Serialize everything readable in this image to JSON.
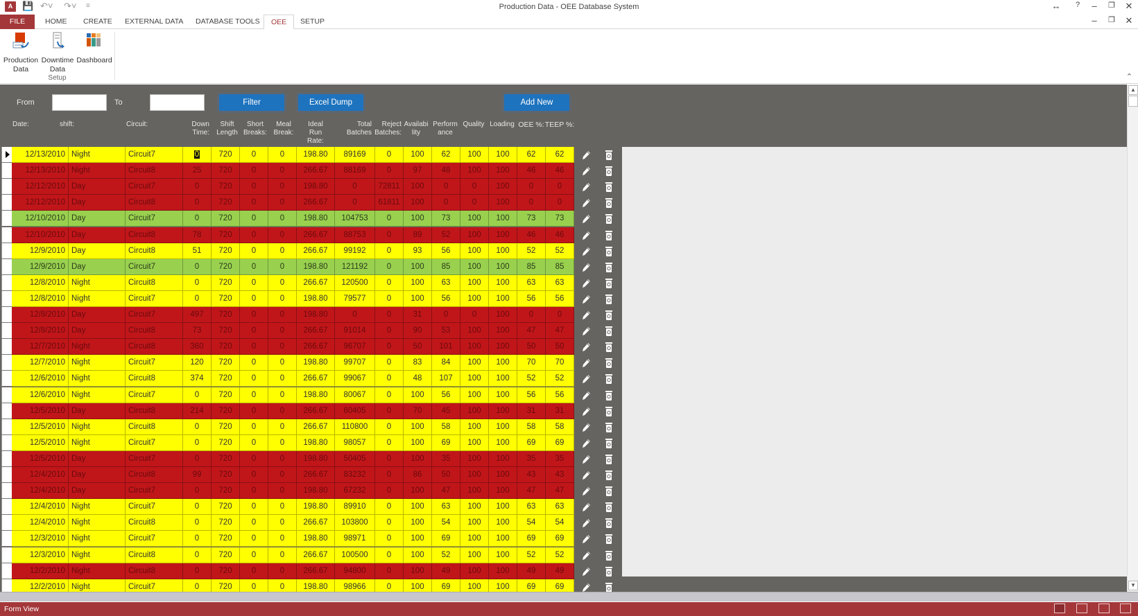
{
  "window": {
    "title": "Production Data - OEE Database System",
    "app_icon": "access-icon",
    "quick_access": [
      "save-icon",
      "undo-icon",
      "redo-icon",
      "customize-icon"
    ],
    "controls": [
      "resize-arrows-icon",
      "help-icon",
      "minimize-icon",
      "restore-icon",
      "close-icon"
    ]
  },
  "ribbon": {
    "tabs": [
      {
        "label": "FILE"
      },
      {
        "label": "HOME"
      },
      {
        "label": "CREATE"
      },
      {
        "label": "EXTERNAL DATA"
      },
      {
        "label": "DATABASE TOOLS"
      },
      {
        "label": "OEE"
      },
      {
        "label": "SETUP"
      }
    ],
    "active_tab": "OEE",
    "buttons": [
      {
        "label1": "Production",
        "label2": "Data",
        "icon": "production-data-icon"
      },
      {
        "label1": "Downtime",
        "label2": "Data",
        "icon": "downtime-data-icon"
      },
      {
        "label1": "Dashboard",
        "label2": "",
        "icon": "dashboard-icon"
      }
    ],
    "group_label": "Setup"
  },
  "filter_bar": {
    "from_label": "From",
    "from_value": "",
    "to_label": "To",
    "to_value": "",
    "filter_button": "Filter",
    "excel_button": "Excel Dump",
    "add_button": "Add New"
  },
  "columns": [
    "Date:",
    "shift:",
    "Circuit:",
    "Down\nTime:",
    "Shift\nLength",
    "Short\nBreaks:",
    "Meal\nBreak:",
    "Ideal\nRun\nRate:",
    "Total\nBatches",
    "Reject\nBatches:",
    "Availabi\nlity",
    "Perform\nance",
    "Quality",
    "Loading",
    "OEE %:",
    "TEEP %:"
  ],
  "colors": {
    "good": "#99d14f",
    "warning": "#ffff00",
    "bad": "#c0161a",
    "accent": "#a4373a",
    "button": "#1e73be"
  },
  "rows": [
    {
      "status": "yellow",
      "cells": [
        "12/13/2010",
        "Night",
        "Circuit7",
        "0",
        "720",
        "0",
        "0",
        "198.80",
        "89169",
        "0",
        "100",
        "62",
        "100",
        "100",
        "62",
        "62"
      ]
    },
    {
      "status": "red",
      "cells": [
        "12/13/2010",
        "Night",
        "Circuit8",
        "25",
        "720",
        "0",
        "0",
        "266.67",
        "88169",
        "0",
        "97",
        "48",
        "100",
        "100",
        "46",
        "46"
      ]
    },
    {
      "status": "red",
      "cells": [
        "12/12/2010",
        "Day",
        "Circuit7",
        "0",
        "720",
        "0",
        "0",
        "198.80",
        "0",
        "72811",
        "100",
        "0",
        "0",
        "100",
        "0",
        "0"
      ]
    },
    {
      "status": "red",
      "cells": [
        "12/12/2010",
        "Day",
        "Circuit8",
        "0",
        "720",
        "0",
        "0",
        "266.67",
        "0",
        "61811",
        "100",
        "0",
        "0",
        "100",
        "0",
        "0"
      ]
    },
    {
      "status": "green",
      "cells": [
        "12/10/2010",
        "Day",
        "Circuit7",
        "0",
        "720",
        "0",
        "0",
        "198.80",
        "104753",
        "0",
        "100",
        "73",
        "100",
        "100",
        "73",
        "73"
      ]
    },
    {
      "status": "red",
      "cells": [
        "12/10/2010",
        "Day",
        "Circuit8",
        "78",
        "720",
        "0",
        "0",
        "266.67",
        "88753",
        "0",
        "89",
        "52",
        "100",
        "100",
        "46",
        "46"
      ]
    },
    {
      "status": "yellow",
      "cells": [
        "12/9/2010",
        "Day",
        "Circuit8",
        "51",
        "720",
        "0",
        "0",
        "266.67",
        "99192",
        "0",
        "93",
        "56",
        "100",
        "100",
        "52",
        "52"
      ]
    },
    {
      "status": "green",
      "cells": [
        "12/9/2010",
        "Day",
        "Circuit7",
        "0",
        "720",
        "0",
        "0",
        "198.80",
        "121192",
        "0",
        "100",
        "85",
        "100",
        "100",
        "85",
        "85"
      ]
    },
    {
      "status": "yellow",
      "cells": [
        "12/8/2010",
        "Night",
        "Circuit8",
        "0",
        "720",
        "0",
        "0",
        "266.67",
        "120500",
        "0",
        "100",
        "63",
        "100",
        "100",
        "63",
        "63"
      ]
    },
    {
      "status": "yellow",
      "cells": [
        "12/8/2010",
        "Night",
        "Circuit7",
        "0",
        "720",
        "0",
        "0",
        "198.80",
        "79577",
        "0",
        "100",
        "56",
        "100",
        "100",
        "56",
        "56"
      ]
    },
    {
      "status": "red",
      "cells": [
        "12/8/2010",
        "Day",
        "Circuit7",
        "497",
        "720",
        "0",
        "0",
        "198.80",
        "0",
        "0",
        "31",
        "0",
        "0",
        "100",
        "0",
        "0"
      ]
    },
    {
      "status": "red",
      "cells": [
        "12/8/2010",
        "Day",
        "Circuit8",
        "73",
        "720",
        "0",
        "0",
        "266.67",
        "91014",
        "0",
        "90",
        "53",
        "100",
        "100",
        "47",
        "47"
      ]
    },
    {
      "status": "red",
      "cells": [
        "12/7/2010",
        "Night",
        "Circuit8",
        "360",
        "720",
        "0",
        "0",
        "266.67",
        "96707",
        "0",
        "50",
        "101",
        "100",
        "100",
        "50",
        "50"
      ]
    },
    {
      "status": "yellow",
      "cells": [
        "12/7/2010",
        "Night",
        "Circuit7",
        "120",
        "720",
        "0",
        "0",
        "198.80",
        "99707",
        "0",
        "83",
        "84",
        "100",
        "100",
        "70",
        "70"
      ]
    },
    {
      "status": "yellow",
      "cells": [
        "12/6/2010",
        "Night",
        "Circuit8",
        "374",
        "720",
        "0",
        "0",
        "266.67",
        "99067",
        "0",
        "48",
        "107",
        "100",
        "100",
        "52",
        "52"
      ]
    },
    {
      "status": "yellow",
      "cells": [
        "12/6/2010",
        "Night",
        "Circuit7",
        "0",
        "720",
        "0",
        "0",
        "198.80",
        "80067",
        "0",
        "100",
        "56",
        "100",
        "100",
        "56",
        "56"
      ]
    },
    {
      "status": "red",
      "cells": [
        "12/5/2010",
        "Day",
        "Circuit8",
        "214",
        "720",
        "0",
        "0",
        "266.67",
        "60405",
        "0",
        "70",
        "45",
        "100",
        "100",
        "31",
        "31"
      ]
    },
    {
      "status": "yellow",
      "cells": [
        "12/5/2010",
        "Night",
        "Circuit8",
        "0",
        "720",
        "0",
        "0",
        "266.67",
        "110800",
        "0",
        "100",
        "58",
        "100",
        "100",
        "58",
        "58"
      ]
    },
    {
      "status": "yellow",
      "cells": [
        "12/5/2010",
        "Night",
        "Circuit7",
        "0",
        "720",
        "0",
        "0",
        "198.80",
        "98057",
        "0",
        "100",
        "69",
        "100",
        "100",
        "69",
        "69"
      ]
    },
    {
      "status": "red",
      "cells": [
        "12/5/2010",
        "Day",
        "Circuit7",
        "0",
        "720",
        "0",
        "0",
        "198.80",
        "50405",
        "0",
        "100",
        "35",
        "100",
        "100",
        "35",
        "35"
      ]
    },
    {
      "status": "red",
      "cells": [
        "12/4/2010",
        "Day",
        "Circuit8",
        "99",
        "720",
        "0",
        "0",
        "266.67",
        "83232",
        "0",
        "86",
        "50",
        "100",
        "100",
        "43",
        "43"
      ]
    },
    {
      "status": "red",
      "cells": [
        "12/4/2010",
        "Day",
        "Circuit7",
        "0",
        "720",
        "0",
        "0",
        "198.80",
        "67232",
        "0",
        "100",
        "47",
        "100",
        "100",
        "47",
        "47"
      ]
    },
    {
      "status": "yellow",
      "cells": [
        "12/4/2010",
        "Night",
        "Circuit7",
        "0",
        "720",
        "0",
        "0",
        "198.80",
        "89910",
        "0",
        "100",
        "63",
        "100",
        "100",
        "63",
        "63"
      ]
    },
    {
      "status": "yellow",
      "cells": [
        "12/4/2010",
        "Night",
        "Circuit8",
        "0",
        "720",
        "0",
        "0",
        "266.67",
        "103800",
        "0",
        "100",
        "54",
        "100",
        "100",
        "54",
        "54"
      ]
    },
    {
      "status": "yellow",
      "cells": [
        "12/3/2010",
        "Night",
        "Circuit7",
        "0",
        "720",
        "0",
        "0",
        "198.80",
        "98971",
        "0",
        "100",
        "69",
        "100",
        "100",
        "69",
        "69"
      ]
    },
    {
      "status": "yellow",
      "cells": [
        "12/3/2010",
        "Night",
        "Circuit8",
        "0",
        "720",
        "0",
        "0",
        "266.67",
        "100500",
        "0",
        "100",
        "52",
        "100",
        "100",
        "52",
        "52"
      ]
    },
    {
      "status": "red",
      "cells": [
        "12/2/2010",
        "Night",
        "Circuit8",
        "0",
        "720",
        "0",
        "0",
        "266.67",
        "94800",
        "0",
        "100",
        "49",
        "100",
        "100",
        "49",
        "49"
      ]
    },
    {
      "status": "yellow",
      "cells": [
        "12/2/2010",
        "Night",
        "Circuit7",
        "0",
        "720",
        "0",
        "0",
        "198.80",
        "98966",
        "0",
        "100",
        "69",
        "100",
        "100",
        "69",
        "69"
      ]
    }
  ],
  "row_actions": {
    "edit_icon": "pencil-icon",
    "delete_icon": "trash-icon"
  },
  "status_bar": {
    "text": "Form View",
    "views": [
      "form-view-icon",
      "datasheet-view-icon",
      "layout-view-icon",
      "design-view-icon"
    ]
  }
}
